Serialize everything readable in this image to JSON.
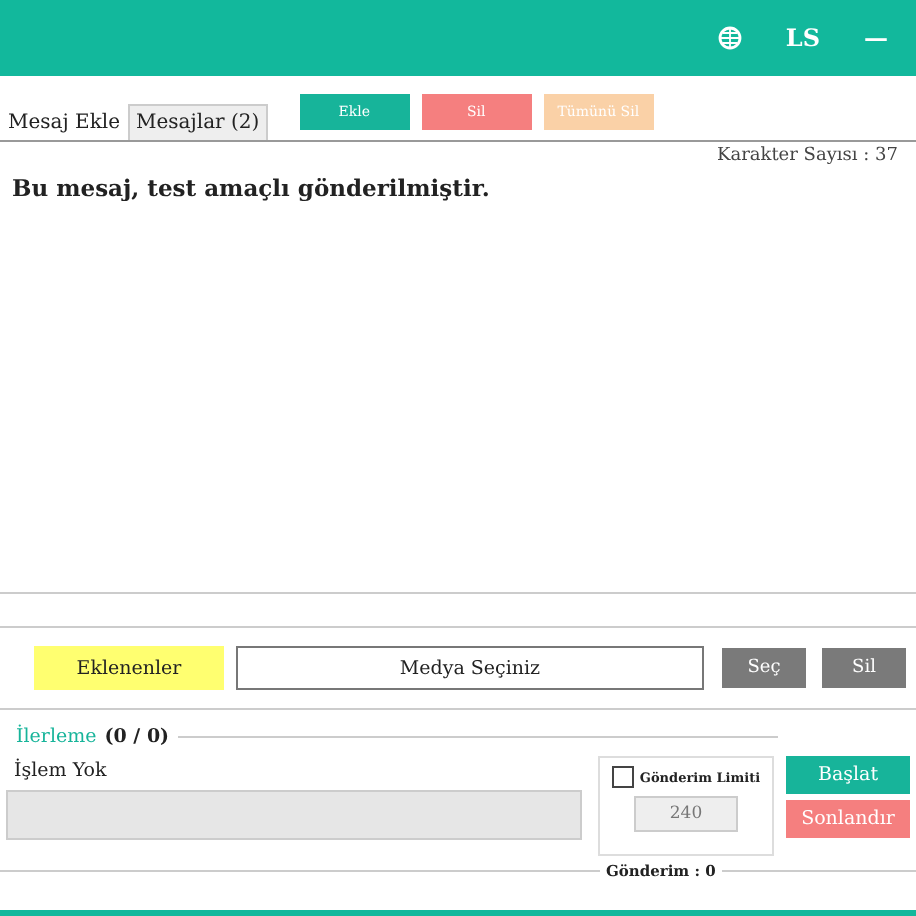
{
  "header": {
    "language_label": "LS",
    "minimize": "—"
  },
  "tabs": [
    {
      "label": "Mesaj Ekle",
      "selected": true
    },
    {
      "label": "Mesajlar (2)",
      "selected": false
    }
  ],
  "actions": [
    {
      "label": "Ekle",
      "kind": "add",
      "disabled": false
    },
    {
      "label": "Sil",
      "kind": "delete",
      "disabled": false
    },
    {
      "label": "Tümünü Sil",
      "kind": "clear",
      "disabled": true
    }
  ],
  "character_count": "Karakter Sayısı : 37",
  "message": "Bu mesaj, test amaçlı gönderilmiştir.",
  "media": {
    "added_label": "Eklenenler",
    "field_value": "Medya Seçiniz",
    "choose": "Seç",
    "remove": "Sil"
  },
  "progress": {
    "legend": "İlerleme",
    "count": "(0 / 0)",
    "status": "İşlem Yok"
  },
  "limit": {
    "label": "Gönderim Limiti",
    "checked": false,
    "value": "240"
  },
  "start": "Başlat",
  "stop": "Sonlandır",
  "sent": "Gönderim : 0"
}
